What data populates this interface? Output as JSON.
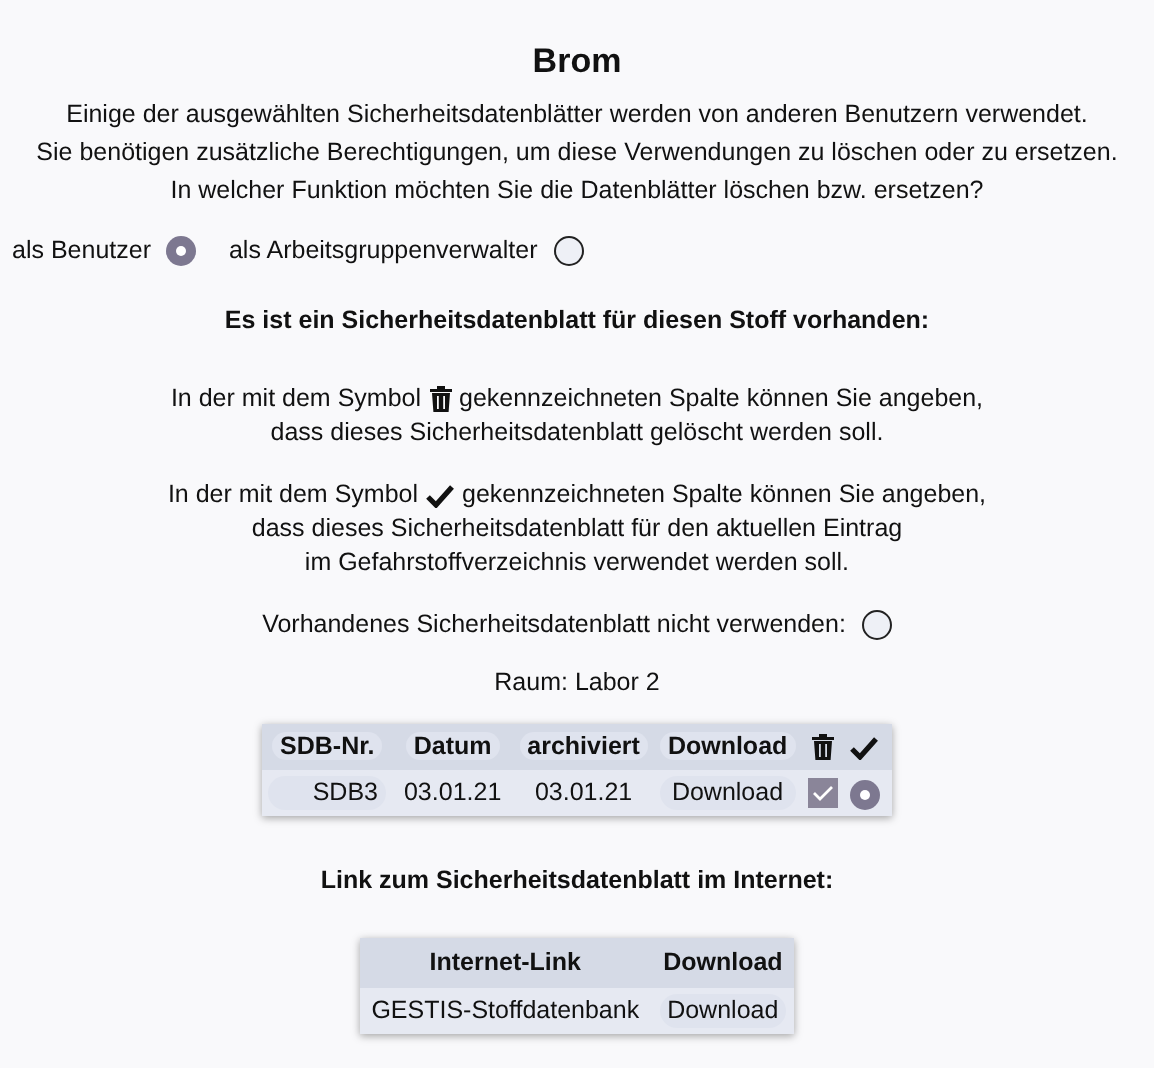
{
  "title": "Brom",
  "intro": [
    "Einige der ausgewählten Sicherheitsdatenblätter werden von anderen Benutzern verwendet.",
    "Sie benötigen zusätzliche Berechtigungen, um diese Verwendungen zu löschen oder zu ersetzen.",
    "In welcher Funktion möchten Sie die Datenblätter löschen bzw. ersetzen?"
  ],
  "roles": [
    {
      "label": "als Benutzer",
      "selected": true
    },
    {
      "label": "als Arbeitsgruppenverwalter",
      "selected": false
    }
  ],
  "heading": "Es ist ein Sicherheitsdatenblatt für diesen Stoff vorhanden:",
  "hints": [
    {
      "kind": "trash",
      "before": "In der mit dem Symbol",
      "after": "gekennzeichneten Spalte können Sie angeben,",
      "lines": [
        "dass dieses Sicherheitsdatenblatt gelöscht werden soll."
      ]
    },
    {
      "kind": "check",
      "before": "In der mit dem Symbol",
      "after": "gekennzeichneten Spalte können Sie angeben,",
      "lines": [
        "dass dieses Sicherheitsdatenblatt für den aktuellen Eintrag",
        "im Gefahrstoffverzeichnis verwendet werden soll."
      ]
    }
  ],
  "dont_use": {
    "label": "Vorhandenes Sicherheitsdatenblatt nicht verwenden:",
    "selected": false
  },
  "room": "Raum: Labor 2",
  "sdb_table": {
    "columns": [
      "SDB-Nr.",
      "Datum",
      "archiviert",
      "Download"
    ],
    "rows": [
      {
        "number": "SDB3",
        "date": "03.01.21",
        "archived": "03.01.21",
        "download": "Download",
        "delete_checked": true,
        "use_selected": true
      }
    ]
  },
  "link_heading": "Link zum Sicherheitsdatenblatt im Internet:",
  "link_table": {
    "columns": [
      "Internet-Link",
      "Download"
    ],
    "rows": [
      {
        "link": "GESTIS-Stoffdatenbank",
        "download": "Download"
      }
    ]
  }
}
